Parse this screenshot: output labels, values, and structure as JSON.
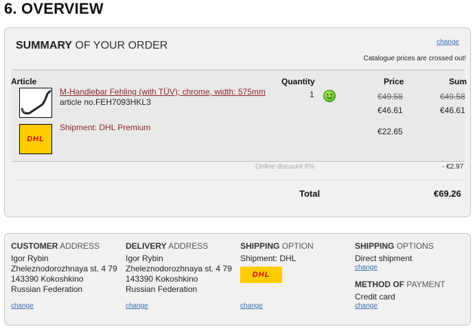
{
  "page": {
    "title": "6. OVERVIEW"
  },
  "summary": {
    "heading_bold": "SUMMARY",
    "heading_rest": " OF YOUR ORDER",
    "change_label": "change",
    "catalogue_note": "Catalogue prices are crossed out!",
    "columns": {
      "article": "Article",
      "quantity": "Quantity",
      "price": "Price",
      "sum": "Sum"
    },
    "item": {
      "name": "M-Handlebar Fehling (with TÜV); chrome, width: 575mm",
      "article_no": "article no.FEH7093HKL3",
      "quantity": "1",
      "old_price": "€49.58",
      "price": "€46.61",
      "old_sum": "€49.58",
      "sum": "€46.61",
      "availability_icon": "smiley-icon"
    },
    "shipment": {
      "label": "Shipment: DHL Premium",
      "price": "€22.65",
      "logo_text": "DHL"
    },
    "discount": {
      "label": "Online discount 6%",
      "value": "- €2.97"
    },
    "total": {
      "label": "Total",
      "value": "€69.26"
    }
  },
  "addresses": {
    "customer": {
      "head_bold": "CUSTOMER",
      "head_rest": " ADDRESS",
      "lines": [
        "Igor Rybin",
        "Zheleznodorozhnaya st. 4 79",
        "143390 Kokoshkino",
        "Russian Federation"
      ],
      "change_label": "change"
    },
    "delivery": {
      "head_bold": "DELIVERY",
      "head_rest": " ADDRESS",
      "lines": [
        "Igor Rybin",
        "Zheleznodorozhnaya st. 4 79",
        "143390 Kokoshkino",
        "Russian Federation"
      ],
      "change_label": "change"
    },
    "shipping_option": {
      "head_bold": "SHIPPING",
      "head_rest": " OPTION",
      "line": "Shipment: DHL",
      "logo_text": "DHL",
      "change_label": "change"
    },
    "shipping_options": {
      "head_bold": "SHIPPING",
      "head_rest": " OPTIONS",
      "line": "Direct shipment",
      "change_label": "change"
    },
    "payment": {
      "head_bold": "METHOD OF",
      "head_rest": " PAYMENT",
      "line": "Credit card",
      "change_label": "change"
    }
  },
  "colors": {
    "panel_bg": "#f1f1f1",
    "link": "#3a6fb5",
    "item_red": "#8b2525",
    "dhl_yellow": "#ffcc00",
    "dhl_red": "#d40511"
  }
}
